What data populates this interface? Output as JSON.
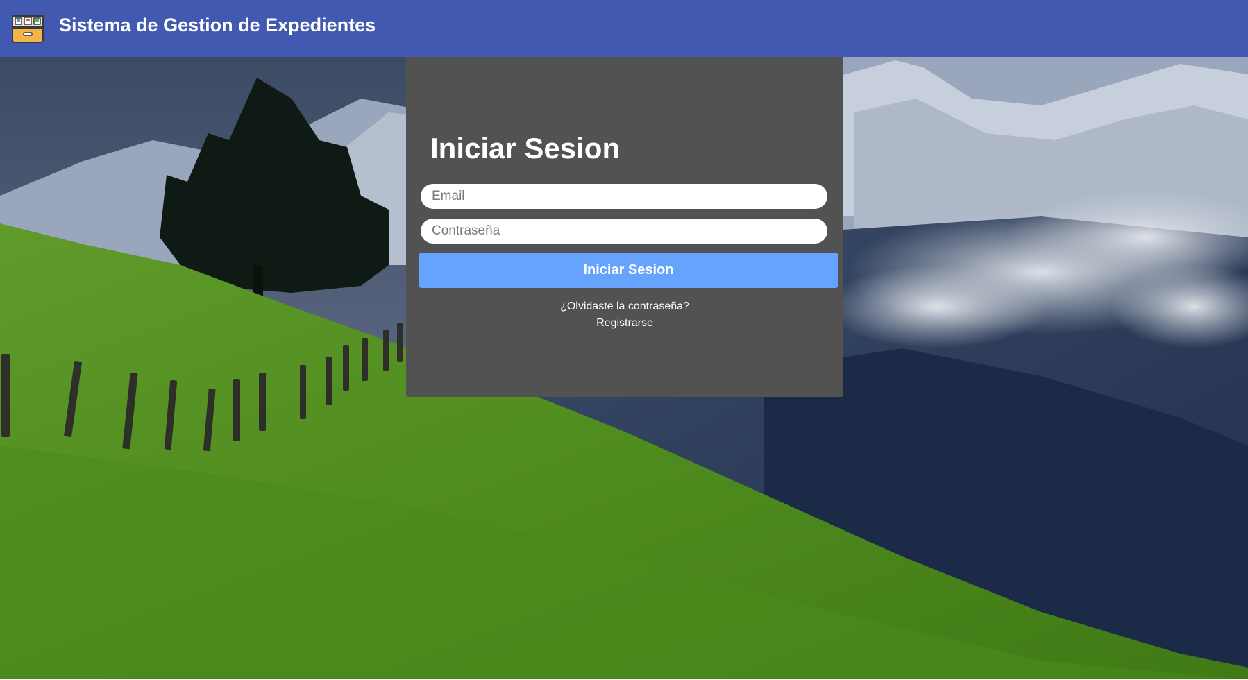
{
  "header": {
    "app_title": "Sistema de Gestion de Expedientes",
    "logo_icon": "file-cabinet-icon",
    "background_color": "#4159b1"
  },
  "login": {
    "title": "Iniciar Sesion",
    "email_placeholder": "Email",
    "email_value": "",
    "password_placeholder": "Contraseña",
    "password_value": "",
    "submit_label": "Iniciar Sesion",
    "forgot_password_label": "¿Olvidaste la contraseña?",
    "register_label": "Registrarse",
    "card_color": "#525252",
    "button_color": "#66a3ff"
  },
  "background": {
    "description_icon": "mountain-landscape-image"
  }
}
